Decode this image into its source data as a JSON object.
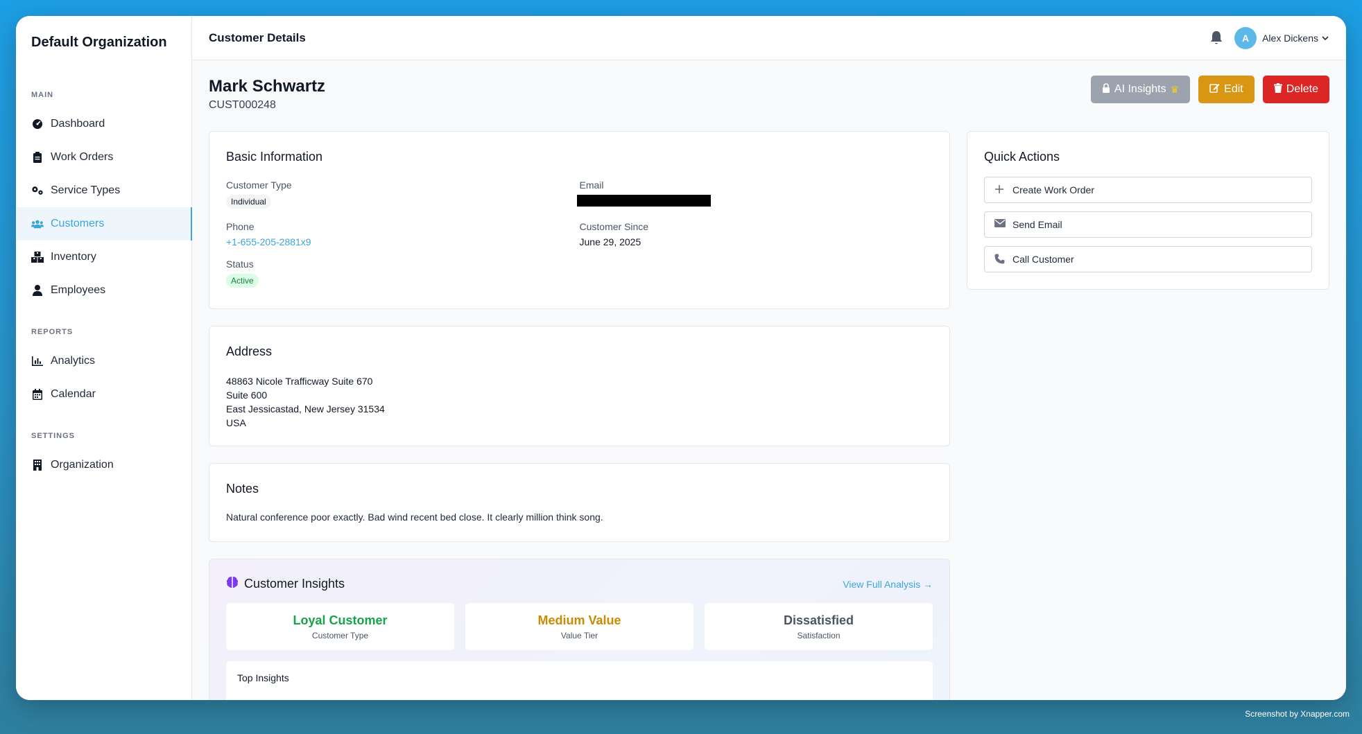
{
  "org": {
    "name": "Default Organization"
  },
  "nav": {
    "main_title": "MAIN",
    "main_items": [
      {
        "label": "Dashboard",
        "icon": "dashboard-icon"
      },
      {
        "label": "Work Orders",
        "icon": "clipboard-icon"
      },
      {
        "label": "Service Types",
        "icon": "gears-icon"
      },
      {
        "label": "Customers",
        "icon": "users-icon",
        "active": true
      },
      {
        "label": "Inventory",
        "icon": "boxes-icon"
      },
      {
        "label": "Employees",
        "icon": "user-icon"
      }
    ],
    "reports_title": "REPORTS",
    "reports_items": [
      {
        "label": "Analytics",
        "icon": "chart-icon"
      },
      {
        "label": "Calendar",
        "icon": "calendar-icon"
      }
    ],
    "settings_title": "SETTINGS",
    "settings_items": [
      {
        "label": "Organization",
        "icon": "building-icon"
      }
    ]
  },
  "topbar": {
    "title": "Customer Details",
    "user_initial": "A",
    "user_name": "Alex Dickens"
  },
  "customer": {
    "name": "Mark Schwartz",
    "id": "CUST000248"
  },
  "actions": {
    "ai_insights": "AI Insights",
    "edit": "Edit",
    "delete": "Delete"
  },
  "basic_info": {
    "title": "Basic Information",
    "customer_type_label": "Customer Type",
    "customer_type": "Individual",
    "email_label": "Email",
    "phone_label": "Phone",
    "phone": "+1-655-205-2881x9",
    "customer_since_label": "Customer Since",
    "customer_since": "June 29, 2025",
    "status_label": "Status",
    "status": "Active"
  },
  "address": {
    "title": "Address",
    "line1": "48863 Nicole Trafficway Suite 670",
    "line2": "Suite 600",
    "line3": "East Jessicastad, New Jersey 31534",
    "line4": "USA"
  },
  "notes": {
    "title": "Notes",
    "text": "Natural conference poor exactly. Bad wind recent bed close. It clearly million think song."
  },
  "insights": {
    "title": "Customer Insights",
    "view_link": "View Full Analysis →",
    "tiles": [
      {
        "value": "Loyal Customer",
        "label": "Customer Type",
        "color": "#16a34a"
      },
      {
        "value": "Medium Value",
        "label": "Value Tier",
        "color": "#ca8a04"
      },
      {
        "value": "Dissatisfied",
        "label": "Satisfaction",
        "color": "#4b5563"
      }
    ],
    "top_title": "Top Insights"
  },
  "quick_actions": {
    "title": "Quick Actions",
    "create_work_order": "Create Work Order",
    "send_email": "Send Email",
    "call_customer": "Call Customer"
  },
  "watermark": "Screenshot by Xnapper.com",
  "colors": {
    "accent": "#3ca4dc",
    "edit": "#d89613",
    "delete": "#dc2626",
    "ai_disabled": "#9ca3af"
  }
}
